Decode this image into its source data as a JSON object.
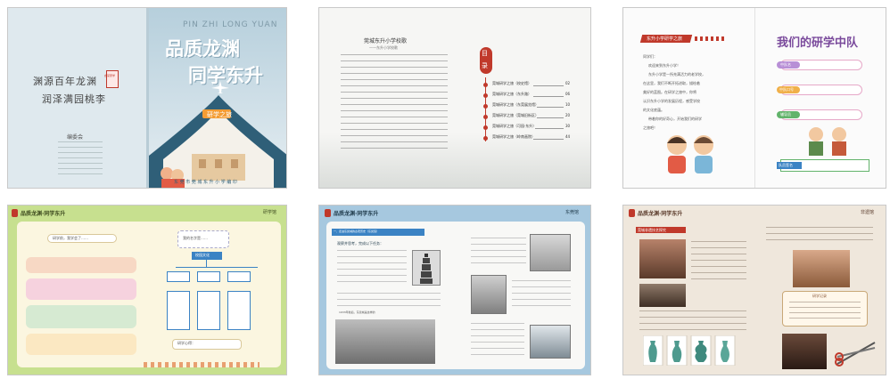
{
  "cover": {
    "pinyin": "PIN ZHI LONG YUAN",
    "title_line1": "品质龙渊",
    "title_line2": "同学东升",
    "poem_line1": "渊源百年龙渊",
    "poem_line2": "润泽满园桃李",
    "seal": "启蒙研学",
    "badge": "研学之旅",
    "credits_title": "编委会",
    "publisher": "东 莞 市 莞 城 东 升 小 学  编 印"
  },
  "toc": {
    "song_title": "莞城东升小学校歌",
    "song_subtitle": "——东升小学校歌",
    "heading": "目录",
    "items": [
      {
        "label": "莞城研学之旅（校史馆）",
        "page": "02"
      },
      {
        "label": "莞城研学之旅（东升路）",
        "page": "06"
      },
      {
        "label": "莞城研学之旅（东莞展览馆）",
        "page": "10"
      },
      {
        "label": "莞城研学之旅（莞城旧街区）",
        "page": "20"
      },
      {
        "label": "莞城研学之旅（可园·东升）",
        "page": "30"
      },
      {
        "label": "莞城研学之旅（岭南画院）",
        "page": "44"
      }
    ]
  },
  "intro": {
    "banner": "东升小学研学之旅",
    "greeting": "同学们：",
    "body": [
      "欢迎来到东升小学！",
      "东升小学是一所充满活力的老学校，",
      "在这里，我们不断开拓进取，描绘着",
      "美好的蓝图。在研学之旅中，你将",
      "认识东升小学的发展历程，感受学校",
      "的文化底蕴。",
      "带着你的好奇心，开始我们的研学",
      "之旅吧！"
    ],
    "side_title": "我们的研学中队",
    "tags": [
      "中队名",
      "中队口号",
      "辅导员",
      "队员签名"
    ]
  },
  "page4": {
    "header": "品质龙渊·同学东升",
    "tag": "研学馆",
    "bubble": "研学前，我学会了……",
    "note": "我的名字是……",
    "diagram_title": "校园文化",
    "footer": "研学心得："
  },
  "page5": {
    "header": "品质龙渊·同学东升",
    "tag": "东莞馆",
    "title_bar": "一、走进东莞城的古老历史（东莞馆）",
    "sub": "观察并思考，完成以下任务：",
    "caption": "1933年前后，东莞城是这样的"
  },
  "page6": {
    "header": "品质龙渊·同学东升",
    "tag": "非遗馆",
    "sub": "莞城非遗技艺探究",
    "scroll_title": "研学记录"
  }
}
